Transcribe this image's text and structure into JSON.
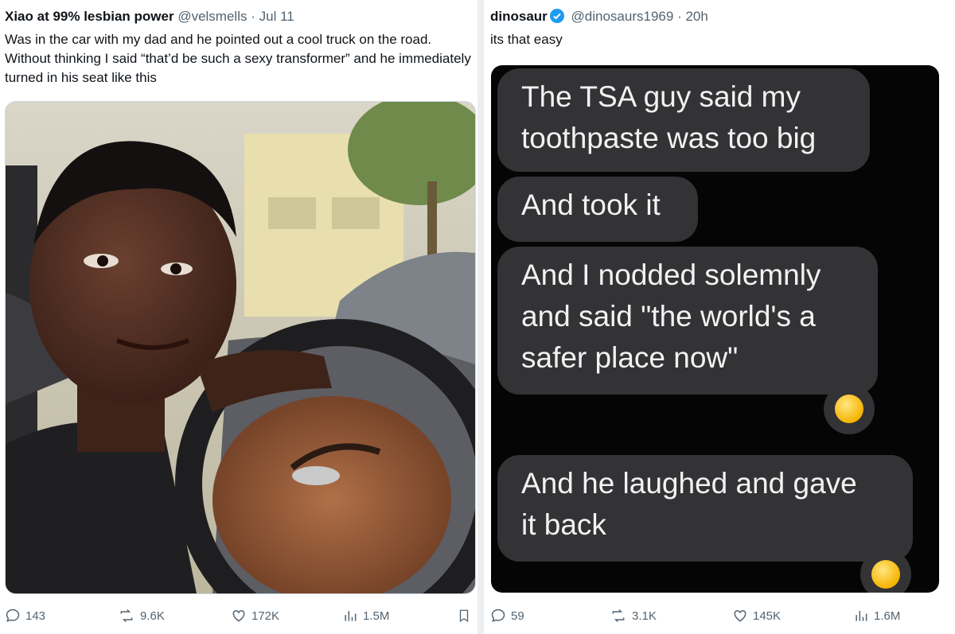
{
  "left_post": {
    "author": "Xiao at 99% lesbian power",
    "handle": "@velsmells",
    "separator": "·",
    "time": "Jul 11",
    "text": "Was in the car with my dad and he pointed out a cool truck on the road. Without thinking I said “that’d be such a sexy transformer” and he immediately turned in his seat like this",
    "stats": {
      "replies": "143",
      "reposts": "9.6K",
      "likes": "172K",
      "views": "1.5M"
    }
  },
  "right_post": {
    "author": "dinosaur",
    "handle": "@dinosaurs1969",
    "separator": "·",
    "time": "20h",
    "text": "its that easy",
    "chat": {
      "messages": [
        {
          "line1": "The TSA guy said my",
          "line2": "toothpaste was too big"
        },
        {
          "line1": "And took it"
        },
        {
          "line1": "And I nodded solemnly",
          "line2": "and said \"the world's a",
          "line3": "safer place now\""
        },
        {
          "line1": "And he laughed and gave",
          "line2": "it back"
        }
      ],
      "reaction_icon": "laughing-emoji-icon"
    },
    "stats": {
      "replies": "59",
      "reposts": "3.1K",
      "likes": "145K",
      "views": "1.6M"
    }
  },
  "colors": {
    "verified": "#1d9bf0",
    "secondary_text": "#536471",
    "chat_bubble": "#333336",
    "chat_background": "#050505"
  }
}
